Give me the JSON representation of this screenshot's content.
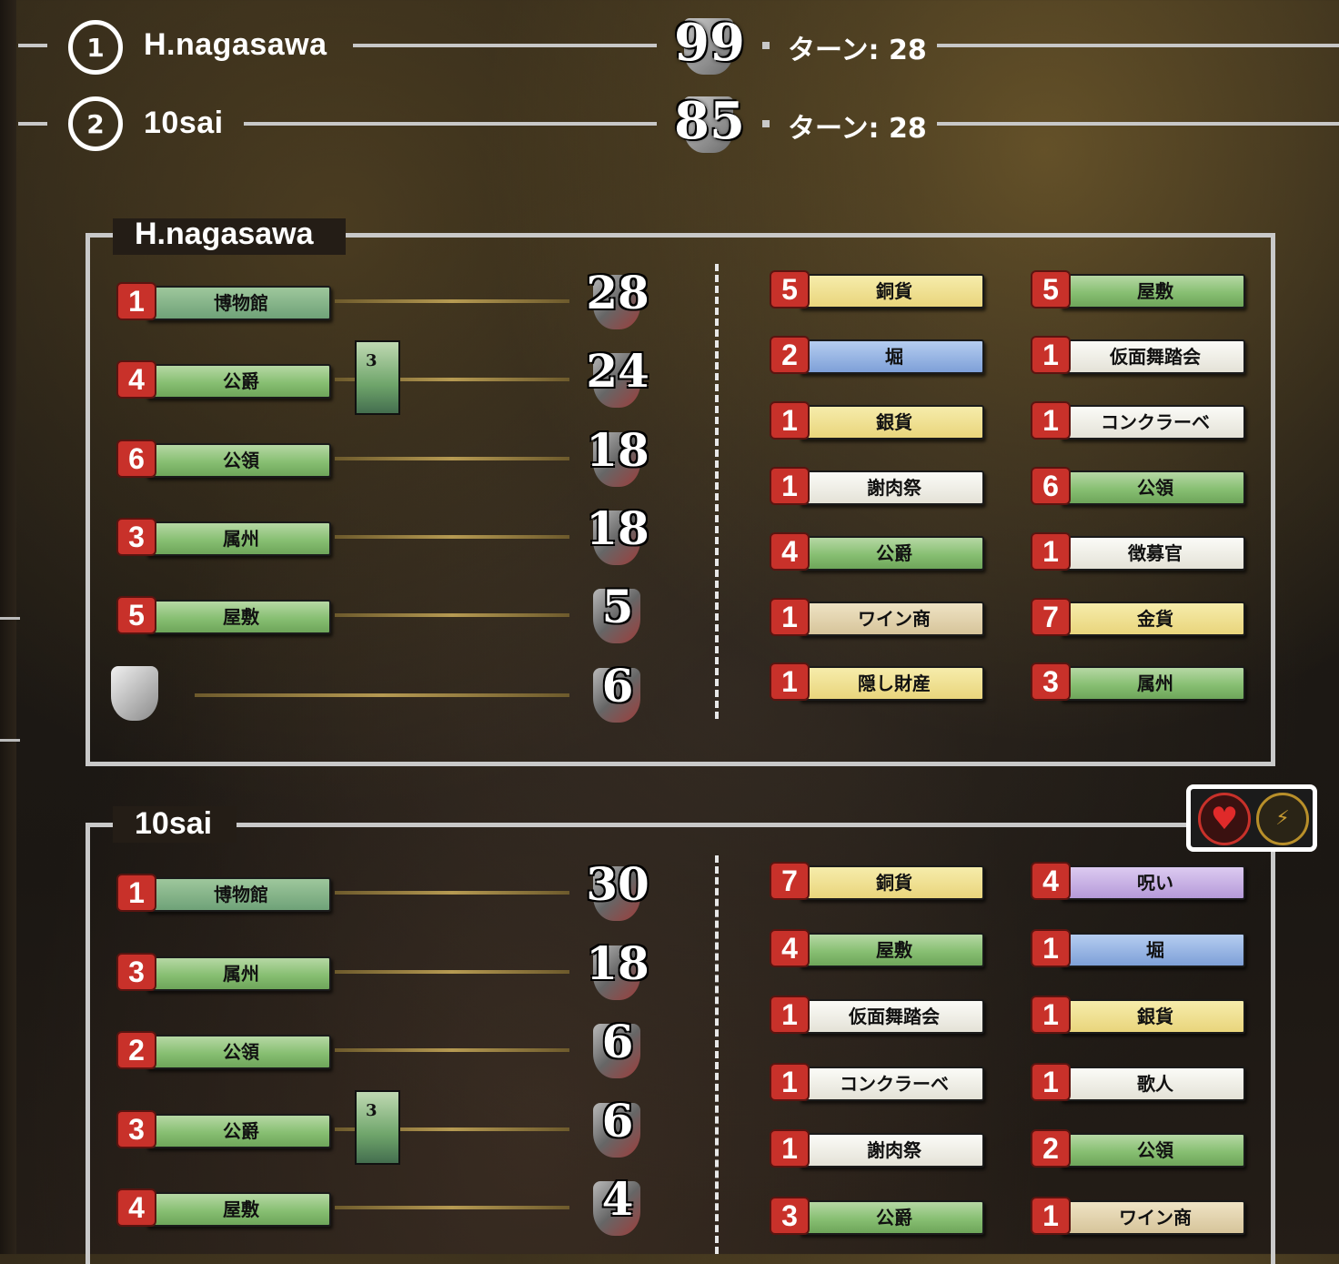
{
  "ranking": [
    {
      "rank": "1",
      "name": "H.nagasawa",
      "score": "99",
      "turn": "ターン: 28"
    },
    {
      "rank": "2",
      "name": "10sai",
      "score": "85",
      "turn": "ターン: 28"
    }
  ],
  "players": [
    {
      "name": "H.nagasawa",
      "score_rows": [
        {
          "count": "1",
          "card": "博物館",
          "score": "28"
        },
        {
          "count": "4",
          "card": "公爵",
          "score": "24",
          "mini_card": "3"
        },
        {
          "count": "6",
          "card": "公領",
          "score": "18"
        },
        {
          "count": "3",
          "card": "属州",
          "score": "18"
        },
        {
          "count": "5",
          "card": "屋敷",
          "score": "5"
        },
        {
          "count": "",
          "card": "",
          "score": "6",
          "token": "victory-token-icon"
        }
      ],
      "deck_left": [
        {
          "count": "5",
          "card": "銅貨",
          "color": "y"
        },
        {
          "count": "2",
          "card": "堀",
          "color": "b"
        },
        {
          "count": "1",
          "card": "銀貨",
          "color": "y"
        },
        {
          "count": "1",
          "card": "謝肉祭",
          "color": "w"
        },
        {
          "count": "4",
          "card": "公爵",
          "color": "g"
        },
        {
          "count": "1",
          "card": "ワイン商",
          "color": "t"
        },
        {
          "count": "1",
          "card": "隠し財産",
          "color": "y"
        }
      ],
      "deck_right": [
        {
          "count": "5",
          "card": "屋敷",
          "color": "g"
        },
        {
          "count": "1",
          "card": "仮面舞踏会",
          "color": "w"
        },
        {
          "count": "1",
          "card": "コンクラーベ",
          "color": "w"
        },
        {
          "count": "6",
          "card": "公領",
          "color": "g"
        },
        {
          "count": "1",
          "card": "徴募官",
          "color": "w"
        },
        {
          "count": "7",
          "card": "金貨",
          "color": "y"
        },
        {
          "count": "3",
          "card": "属州",
          "color": "g"
        }
      ]
    },
    {
      "name": "10sai",
      "score_rows": [
        {
          "count": "1",
          "card": "博物館",
          "score": "30"
        },
        {
          "count": "3",
          "card": "属州",
          "score": "18"
        },
        {
          "count": "2",
          "card": "公領",
          "score": "6"
        },
        {
          "count": "3",
          "card": "公爵",
          "score": "6",
          "mini_card": "3"
        },
        {
          "count": "4",
          "card": "屋敷",
          "score": "4"
        }
      ],
      "deck_left": [
        {
          "count": "7",
          "card": "銅貨",
          "color": "y"
        },
        {
          "count": "4",
          "card": "屋敷",
          "color": "g"
        },
        {
          "count": "1",
          "card": "仮面舞踏会",
          "color": "w"
        },
        {
          "count": "1",
          "card": "コンクラーベ",
          "color": "w"
        },
        {
          "count": "1",
          "card": "謝肉祭",
          "color": "w"
        },
        {
          "count": "3",
          "card": "公爵",
          "color": "g"
        }
      ],
      "deck_right": [
        {
          "count": "4",
          "card": "呪い",
          "color": "p"
        },
        {
          "count": "1",
          "card": "堀",
          "color": "b"
        },
        {
          "count": "1",
          "card": "銀貨",
          "color": "y"
        },
        {
          "count": "1",
          "card": "歌人",
          "color": "w"
        },
        {
          "count": "2",
          "card": "公領",
          "color": "g"
        },
        {
          "count": "1",
          "card": "ワイン商",
          "color": "t"
        }
      ],
      "badges": [
        "heart-icon",
        "bolt-icon"
      ]
    }
  ],
  "colors": {
    "count_red": "#c8312a",
    "line": "#c8c8c8",
    "gold": "#b69a52"
  }
}
